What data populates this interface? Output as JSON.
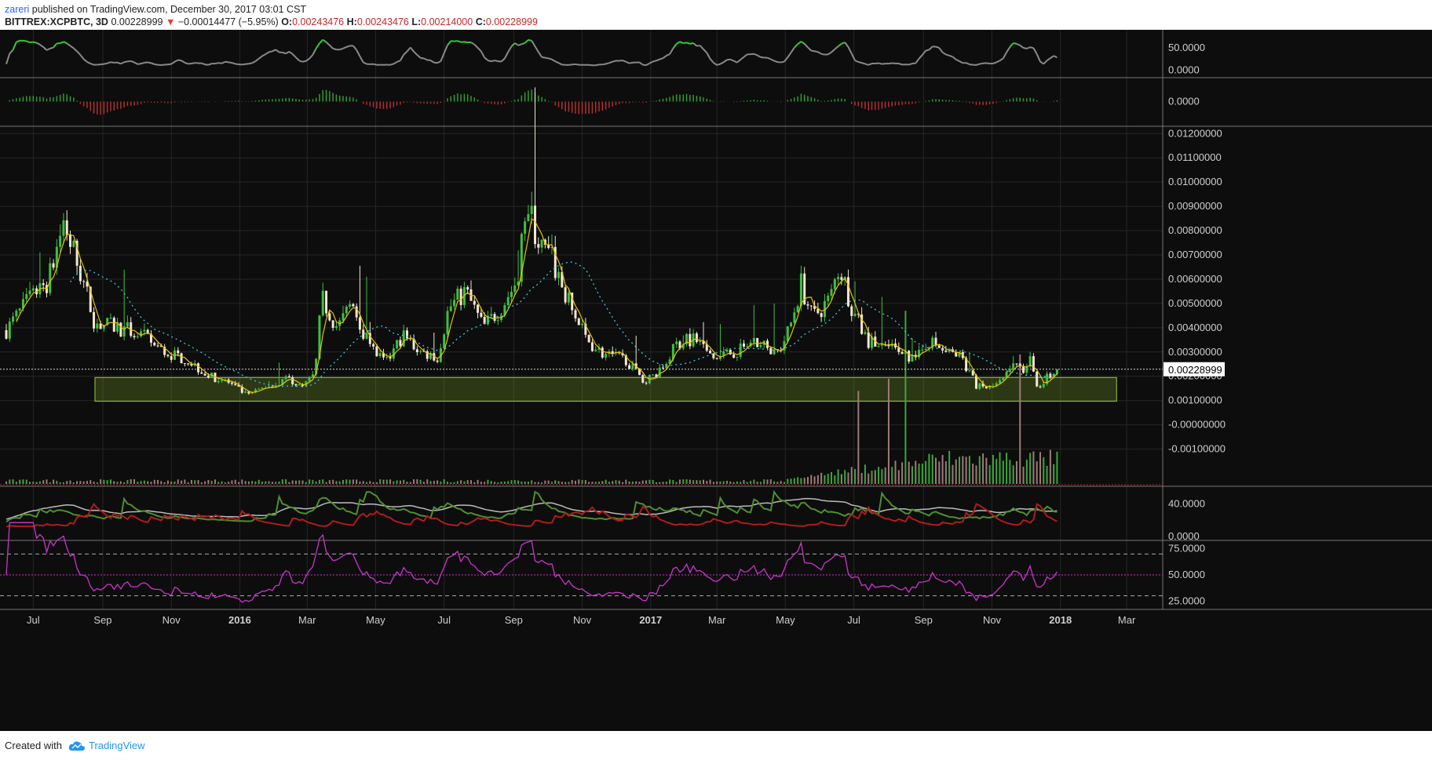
{
  "header": {
    "author": "zareri",
    "published": "published on TradingView.com, December 30, 2017 03:01 CST",
    "symbol": "BITTREX:XCPBTC, 3D",
    "last": "0.00228999",
    "change": "−0.00014477 (−5.95%)",
    "o_label": "O:",
    "o_value": "0.00243476",
    "h_label": "H:",
    "h_value": "0.00243476",
    "l_label": "L:",
    "l_value": "0.00214000",
    "c_label": "C:",
    "c_value": "0.00228999"
  },
  "footer": {
    "created_with": "Created with",
    "brand": "TradingView"
  },
  "colors": {
    "background": "#0d0d0d",
    "grid": "#262626",
    "bull_candle": "#3fbf3f",
    "bear_candle": "#f5e6d3",
    "sma_fast": "#e6c200",
    "sma_slow": "#3fc6d8",
    "support_zone": "#9acd32",
    "rsi": "#cc33cc",
    "dmi_plus": "#4f8f2f",
    "dmi_minus": "#b01c1c",
    "adx": "#bbbbbb"
  },
  "chart_data": {
    "type": "candlestick",
    "symbol": "BITTREX:XCPBTC",
    "interval": "3D",
    "x_tick_labels": [
      "Jul",
      "Sep",
      "Nov",
      "2016",
      "Mar",
      "May",
      "Jul",
      "Sep",
      "Nov",
      "2017",
      "Mar",
      "May",
      "Jul",
      "Sep",
      "Nov",
      "2018",
      "Mar"
    ],
    "x_tick_dates": [
      "2015-07-01",
      "2015-09-01",
      "2015-11-01",
      "2016-01-01",
      "2016-03-01",
      "2016-05-01",
      "2016-07-01",
      "2016-09-01",
      "2016-11-01",
      "2017-01-01",
      "2017-03-01",
      "2017-05-01",
      "2017-07-01",
      "2017-09-01",
      "2017-11-01",
      "2018-01-01",
      "2018-03-01"
    ],
    "x_range": [
      "2015-06-07",
      "2018-03-31"
    ],
    "price_axis": {
      "ylim": [
        -0.0025,
        0.0123
      ],
      "tick_labels": [
        "0.01200000",
        "0.01100000",
        "0.01000000",
        "0.00900000",
        "0.00800000",
        "0.00700000",
        "0.00600000",
        "0.00500000",
        "0.00400000",
        "0.00300000",
        "0.00200000",
        "0.00100000",
        "-0.00000000",
        "-0.00100000"
      ],
      "ticks": [
        0.012,
        0.011,
        0.01,
        0.009,
        0.008,
        0.007,
        0.006,
        0.005,
        0.004,
        0.003,
        0.002,
        0.001,
        0.0,
        -0.001
      ],
      "last_price_label": "0.00228999",
      "last_price": 0.00228999
    },
    "price_path": [
      [
        "2015-06-07",
        0.0039
      ],
      [
        "2015-06-25",
        0.005
      ],
      [
        "2015-07-15",
        0.006
      ],
      [
        "2015-07-28",
        0.0084
      ],
      [
        "2015-08-15",
        0.0058
      ],
      [
        "2015-08-25",
        0.0042
      ],
      [
        "2015-09-15",
        0.004
      ],
      [
        "2015-10-05",
        0.0037
      ],
      [
        "2015-10-25",
        0.003
      ],
      [
        "2015-11-15",
        0.0027
      ],
      [
        "2015-12-05",
        0.002
      ],
      [
        "2015-12-20",
        0.0018
      ],
      [
        "2016-01-08",
        0.0012
      ],
      [
        "2016-01-25",
        0.0016
      ],
      [
        "2016-02-15",
        0.0019
      ],
      [
        "2016-02-25",
        0.0015
      ],
      [
        "2016-03-08",
        0.0021
      ],
      [
        "2016-03-14",
        0.0052
      ],
      [
        "2016-03-28",
        0.004
      ],
      [
        "2016-04-10",
        0.005
      ],
      [
        "2016-04-25",
        0.0033
      ],
      [
        "2016-05-10",
        0.0025
      ],
      [
        "2016-05-25",
        0.0037
      ],
      [
        "2016-06-10",
        0.003
      ],
      [
        "2016-06-25",
        0.0028
      ],
      [
        "2016-07-05",
        0.0048
      ],
      [
        "2016-07-20",
        0.0055
      ],
      [
        "2016-08-05",
        0.004
      ],
      [
        "2016-08-20",
        0.0048
      ],
      [
        "2016-09-05",
        0.006
      ],
      [
        "2016-09-12",
        0.0093
      ],
      [
        "2016-09-25",
        0.0073
      ],
      [
        "2016-10-05",
        0.0068
      ],
      [
        "2016-10-20",
        0.005
      ],
      [
        "2016-11-05",
        0.0035
      ],
      [
        "2016-11-20",
        0.0029
      ],
      [
        "2016-12-10",
        0.0027
      ],
      [
        "2016-12-25",
        0.0018
      ],
      [
        "2017-01-10",
        0.0022
      ],
      [
        "2017-01-25",
        0.0034
      ],
      [
        "2017-02-10",
        0.0035
      ],
      [
        "2017-02-25",
        0.0027
      ],
      [
        "2017-03-15",
        0.003
      ],
      [
        "2017-04-05",
        0.0034
      ],
      [
        "2017-04-25",
        0.003
      ],
      [
        "2017-05-05",
        0.004
      ],
      [
        "2017-05-15",
        0.0058
      ],
      [
        "2017-05-25",
        0.0044
      ],
      [
        "2017-06-10",
        0.0052
      ],
      [
        "2017-06-18",
        0.0066
      ],
      [
        "2017-07-01",
        0.0046
      ],
      [
        "2017-07-12",
        0.0035
      ],
      [
        "2017-07-25",
        0.0032
      ],
      [
        "2017-08-15",
        0.003
      ],
      [
        "2017-08-25",
        0.0026
      ],
      [
        "2017-09-05",
        0.0035
      ],
      [
        "2017-09-20",
        0.003
      ],
      [
        "2017-10-05",
        0.0028
      ],
      [
        "2017-10-18",
        0.0016
      ],
      [
        "2017-10-30",
        0.0015
      ],
      [
        "2017-11-10",
        0.0018
      ],
      [
        "2017-11-22",
        0.0025
      ],
      [
        "2017-12-01",
        0.0023
      ],
      [
        "2017-12-05",
        0.003
      ],
      [
        "2017-12-10",
        0.0014
      ],
      [
        "2017-12-20",
        0.002
      ],
      [
        "2017-12-30",
        0.00229
      ]
    ],
    "support_zone": {
      "from": "2015-08-25",
      "to": "2018-02-20",
      "low": 0.00097,
      "high": 0.00195
    },
    "volume_starts": "2017-05-01",
    "volume_spikes": [
      [
        "2017-08-15",
        0.0047
      ],
      [
        "2017-11-25",
        0.0029
      ],
      [
        "2017-08-01",
        0.0019
      ],
      [
        "2017-07-05",
        0.0014
      ]
    ],
    "indicators": {
      "stoch_panel": {
        "tick_labels": [
          "50.0000",
          "0.0000"
        ],
        "ticks": [
          50,
          0
        ],
        "ylim": [
          -15,
          90
        ],
        "current": 28
      },
      "macd_histogram": {
        "tick_labels": [
          "0.0000"
        ],
        "ticks": [
          0
        ],
        "ylim": [
          -1,
          1
        ]
      },
      "dmi_adx": {
        "tick_labels": [
          "40.0000",
          "0.0000"
        ],
        "ticks": [
          40,
          0
        ],
        "ylim": [
          -4,
          62
        ]
      },
      "rsi": {
        "tick_labels": [
          "75.0000",
          "50.0000",
          "25.0000"
        ],
        "ticks": [
          75,
          50,
          25
        ],
        "ylim": [
          17,
          83
        ],
        "bands": [
          70,
          30
        ],
        "midline": 50,
        "current": 53
      }
    }
  }
}
